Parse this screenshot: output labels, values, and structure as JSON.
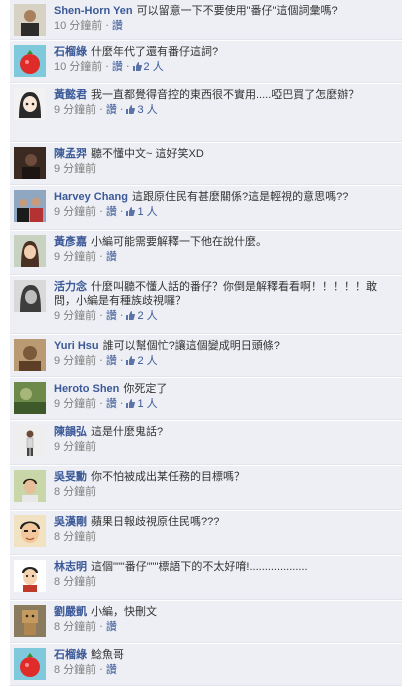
{
  "like_label": "讚",
  "separator": "‧",
  "comments": [
    {
      "name": "Shen-Horn Yen",
      "text": "可以留意一下不要使用\"番仔\"這個詞彙嗎?",
      "time": "10 分鐘前",
      "likes": "",
      "avatar": "avatar-man-photo-icon"
    },
    {
      "name": "石榴綠",
      "text": "什麼年代了還有番仔這詞?",
      "time": "10 分鐘前",
      "likes": "2 人",
      "avatar": "avatar-pomegranate-icon"
    },
    {
      "name": "黃懿君",
      "text": "我一直都覺得音控的東西很不實用.....啞巴買了怎麼辦？",
      "time": "9 分鐘前",
      "likes": "3 人",
      "avatar": "avatar-anime-girl-icon"
    },
    {
      "name": "陳孟羿",
      "text": "聽不懂中文~ 這好笑XD",
      "time": "9 分鐘前",
      "likes": "",
      "avatar": "avatar-dark-photo-icon"
    },
    {
      "name": "Harvey Chang",
      "text": "這跟原住民有甚麼關係?這是輕視的意思嗎??",
      "time": "9 分鐘前",
      "likes": "1 人",
      "avatar": "avatar-group-photo-icon"
    },
    {
      "name": "黃彥嘉",
      "text": "小編可能需要解釋一下他在說什麼。",
      "time": "9 分鐘前",
      "likes": "",
      "avatar": "avatar-girl-photo-icon"
    },
    {
      "name": "活力念",
      "text": "什麼叫聽不懂人話的番仔？你倒是解釋看看啊！！！！！敢問，小編是有種族歧視囉？",
      "time": "9 分鐘前",
      "likes": "2 人",
      "avatar": "avatar-bw-woman-icon"
    },
    {
      "name": "Yuri Hsu",
      "text": "誰可以幫個忙?讓這個變成明日頭條?",
      "time": "9 分鐘前",
      "likes": "2 人",
      "avatar": "avatar-sepia-photo-icon"
    },
    {
      "name": "Heroto Shen",
      "text": "你死定了",
      "time": "9 分鐘前",
      "likes": "1 人",
      "avatar": "avatar-green-scene-icon"
    },
    {
      "name": "陳韻弘",
      "text": "這是什麼鬼話?",
      "time": "9 分鐘前",
      "likes": "",
      "avatar": "avatar-standing-figure-icon"
    },
    {
      "name": "吳旻勳",
      "text": "你不怕被成出某任務的目標嗎？",
      "time": "8 分鐘前",
      "likes": "",
      "avatar": "avatar-boy-photo-icon"
    },
    {
      "name": "吳漢剛",
      "text": "蘋果日報歧視原住民嗎???",
      "time": "8 分鐘前",
      "likes": "",
      "avatar": "avatar-cartoon-face-icon"
    },
    {
      "name": "林志明",
      "text": "這個\"\"\"番仔\"\"\"標語下的不太好唷!...................",
      "time": "8 分鐘前",
      "likes": "",
      "avatar": "avatar-cartoon-man-icon"
    },
    {
      "name": "劉嚴凱",
      "text": "小編，快刪文",
      "time": "8 分鐘前",
      "likes": "",
      "avatar": "avatar-box-robot-icon"
    },
    {
      "name": "石榴綠",
      "text": "鯰魚哥",
      "time": "8 分鐘前",
      "likes": "",
      "avatar": "avatar-pomegranate-icon"
    }
  ]
}
